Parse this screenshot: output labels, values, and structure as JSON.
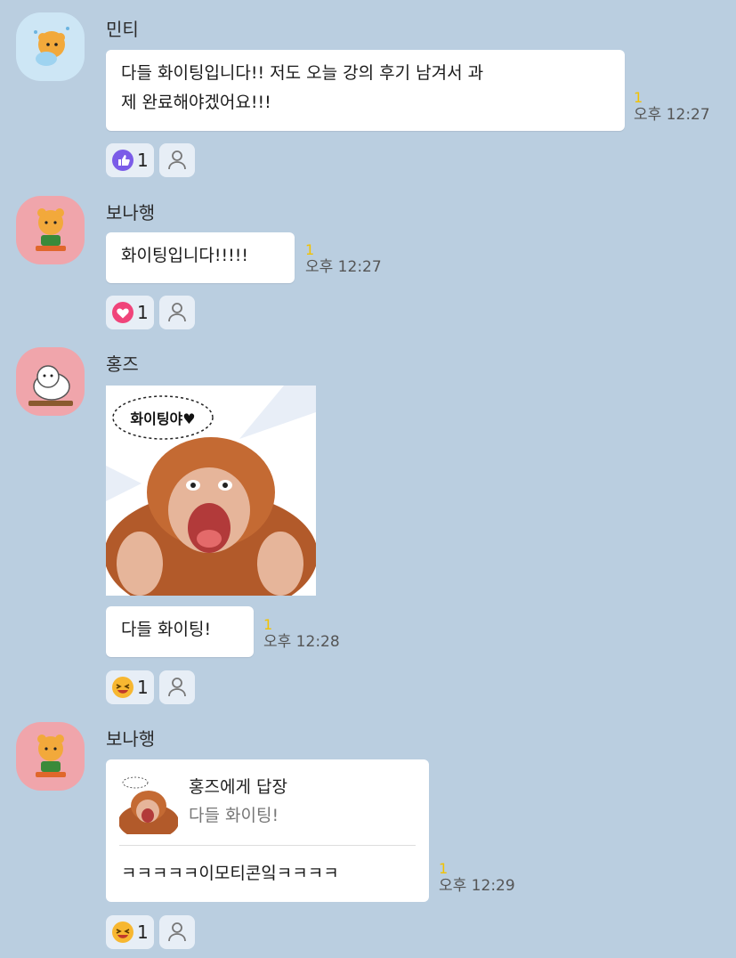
{
  "messages": [
    {
      "sender": "민티",
      "avatar": "mint-lion-avatar",
      "text_lines": [
        "다들 화이팅입니다!! 저도 오늘 강의 후기 남겨서 과",
        "제 완료해야겠어요!!!"
      ],
      "unread": "1",
      "time": "오후 12:27",
      "reaction": {
        "icon": "thumbs-up-icon",
        "count": "1",
        "color": "#7b5ce8"
      }
    },
    {
      "sender": "보나행",
      "avatar": "ryan-bear-avatar",
      "text": "화이팅입니다!!!!!",
      "unread": "1",
      "time": "오후 12:27",
      "reaction": {
        "icon": "heart-icon",
        "count": "1",
        "color": "#f0447a"
      }
    },
    {
      "sender": "홍즈",
      "avatar": "white-cat-avatar",
      "sticker_text": "화이팅야♥",
      "text": "다들 화이팅!",
      "unread": "1",
      "time": "오후 12:28",
      "reaction": {
        "icon": "laughing-face-icon",
        "count": "1",
        "color": "#f7b731"
      }
    },
    {
      "sender": "보나행",
      "avatar": "ryan-bear-avatar",
      "reply_to": "홍즈에게 답장",
      "reply_quote": "다들 화이팅!",
      "text": "ㅋㅋㅋㅋㅋ이모티콘잌ㅋㅋㅋㅋ",
      "unread": "1",
      "time": "오후 12:29",
      "reaction": {
        "icon": "laughing-face-icon",
        "count": "1",
        "color": "#f7b731"
      }
    }
  ]
}
